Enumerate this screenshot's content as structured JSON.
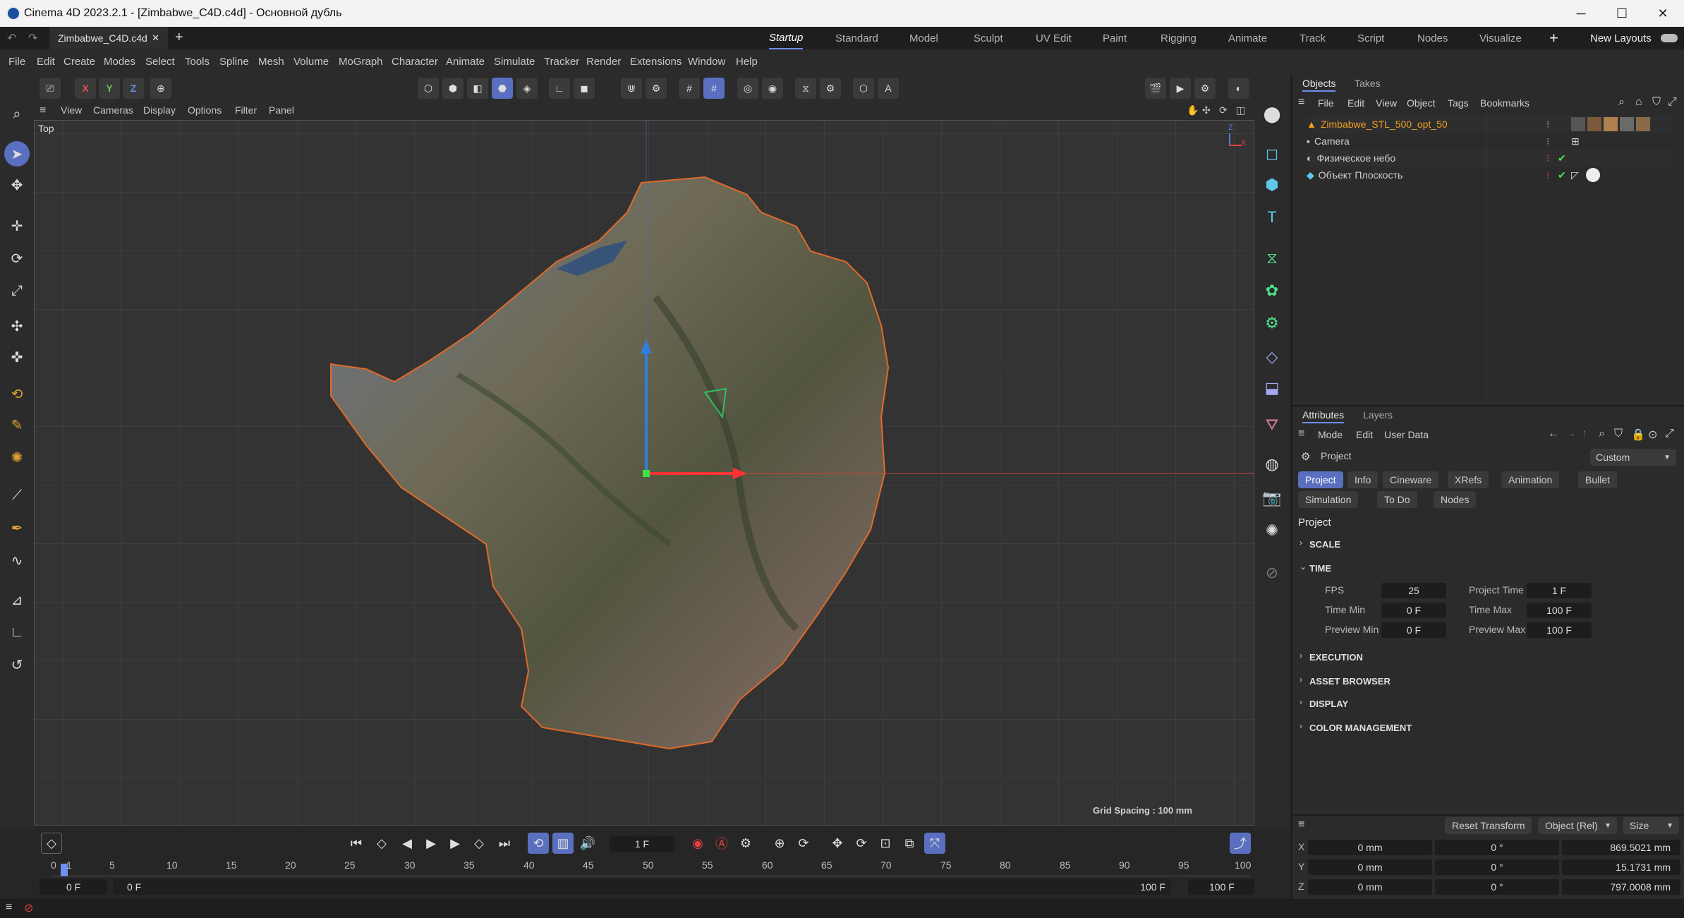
{
  "window": {
    "title": "Cinema 4D 2023.2.1 - [Zimbabwe_C4D.c4d] - Основной дубль",
    "minimize": "─",
    "maximize": "☐",
    "close": "✕"
  },
  "doc_tab": {
    "name": "Zimbabwe_C4D.c4d",
    "close": "✕",
    "add": "+"
  },
  "layouts": {
    "items": [
      "Startup",
      "Standard",
      "Model",
      "Sculpt",
      "UV Edit",
      "Paint",
      "Rigging",
      "Animate",
      "Track",
      "Script",
      "Nodes",
      "Visualize"
    ],
    "active": "Startup",
    "add": "+",
    "new_layouts": "New Layouts"
  },
  "menu": [
    "File",
    "Edit",
    "Create",
    "Modes",
    "Select",
    "Tools",
    "Spline",
    "Mesh",
    "Volume",
    "MoGraph",
    "Character",
    "Animate",
    "Simulate",
    "Tracker",
    "Render",
    "Extensions",
    "Window",
    "Help"
  ],
  "axis_toggles": {
    "x": "X",
    "y": "Y",
    "z": "Z"
  },
  "viewport_menu": [
    "View",
    "Cameras",
    "Display",
    "Options",
    "Filter",
    "Panel"
  ],
  "viewport": {
    "label": "Top",
    "grid_spacing": "Grid Spacing : 100 mm",
    "axis_x": "X",
    "axis_z": "Z"
  },
  "objects_panel": {
    "tabs": [
      "Objects",
      "Takes"
    ],
    "menu": [
      "File",
      "Edit",
      "View",
      "Object",
      "Tags",
      "Bookmarks"
    ],
    "items": [
      {
        "name": "Zimbabwe_STL_500_opt_50",
        "color": "#f0a020"
      },
      {
        "name": "Camera",
        "color": "#d0d0d0"
      },
      {
        "name": "Физическое небо",
        "color": "#d0d0d0"
      },
      {
        "name": "Объект Плоскость",
        "color": "#d0d0d0"
      }
    ]
  },
  "attributes_panel": {
    "tabs": [
      "Attributes",
      "Layers"
    ],
    "menu": [
      "Mode",
      "Edit",
      "User Data"
    ],
    "object_label": "Project",
    "preset": "Custom",
    "subtabs_row1": [
      "Project",
      "Info",
      "Cineware",
      "XRefs",
      "Animation",
      "Bullet"
    ],
    "subtabs_row2": [
      "Simulation",
      "To Do",
      "Nodes"
    ],
    "active_subtab": "Project",
    "section_title": "Project",
    "groups": {
      "scale": "SCALE",
      "time": "TIME",
      "execution": "EXECUTION",
      "asset_browser": "ASSET BROWSER",
      "display": "DISPLAY",
      "color_management": "COLOR MANAGEMENT"
    },
    "time_fields": {
      "fps_label": "FPS",
      "fps": "25",
      "project_time_label": "Project Time",
      "project_time": "1 F",
      "time_min_label": "Time Min",
      "time_min": "0 F",
      "time_max_label": "Time Max",
      "time_max": "100 F",
      "preview_min_label": "Preview Min",
      "preview_min": "0 F",
      "preview_max_label": "Preview Max",
      "preview_max": "100 F"
    }
  },
  "coordinates": {
    "reset": "Reset Transform",
    "mode": "Object (Rel)",
    "size_mode": "Size",
    "rows": [
      {
        "axis": "X",
        "pos": "0 mm",
        "rot": "0 °",
        "size": "869.5021 mm"
      },
      {
        "axis": "Y",
        "pos": "0 mm",
        "rot": "0 °",
        "size": "15.1731 mm"
      },
      {
        "axis": "Z",
        "pos": "0 mm",
        "rot": "0 °",
        "size": "797.0008 mm"
      }
    ]
  },
  "timeline": {
    "current_frame": "1 F",
    "ticks": [
      "0",
      "1",
      "5",
      "10",
      "15",
      "20",
      "25",
      "30",
      "35",
      "40",
      "45",
      "50",
      "55",
      "60",
      "65",
      "70",
      "75",
      "80",
      "85",
      "90",
      "95",
      "100"
    ],
    "start": "0 F",
    "preview_start": "0 F",
    "preview_end": "100 F",
    "end": "100 F"
  }
}
